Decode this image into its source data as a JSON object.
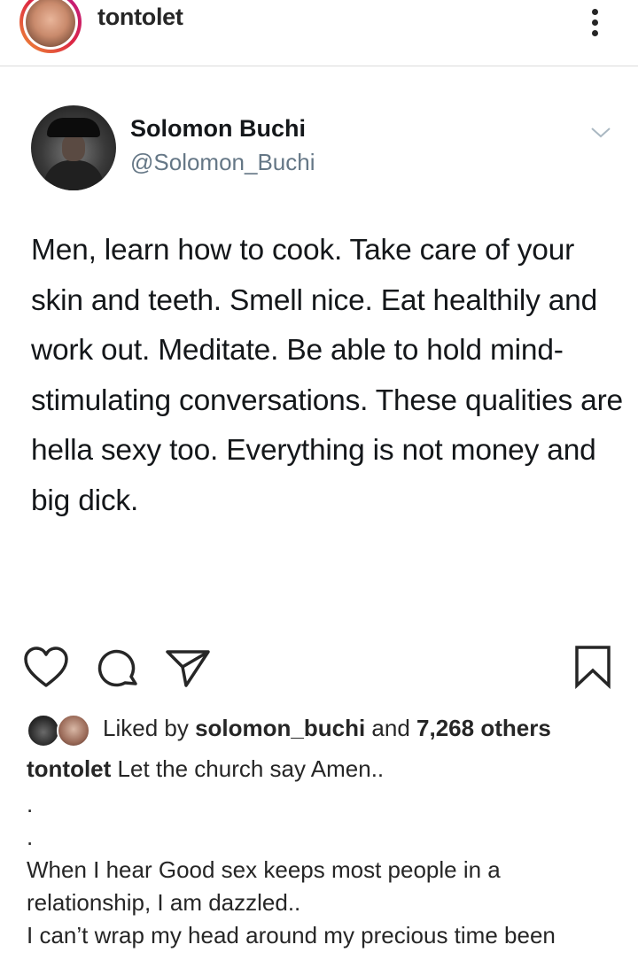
{
  "header": {
    "username": "tontolet"
  },
  "tweet": {
    "name": "Solomon Buchi",
    "handle": "@Solomon_Buchi",
    "text": "Men, learn how to cook. Take care of your skin and teeth. Smell nice. Eat healthily and work out. Meditate. Be able to hold mind-stimulating conversations. These qualities are hella sexy too. Everything is not money and big dick."
  },
  "actions": {
    "like_icon": "heart-icon",
    "comment_icon": "comment-icon",
    "share_icon": "paper-plane-icon",
    "save_icon": "bookmark-icon"
  },
  "likes": {
    "prefix": "Liked by ",
    "user": "solomon_buchi",
    "middle": " and ",
    "count": "7,268 others"
  },
  "caption": {
    "username": "tontolet",
    "text": " Let the church say Amen..",
    "lines": [
      ".",
      ".",
      "When I hear Good sex keeps most people in a relationship, I am dazzled..",
      "I can’t wrap my head around my precious time been"
    ]
  }
}
